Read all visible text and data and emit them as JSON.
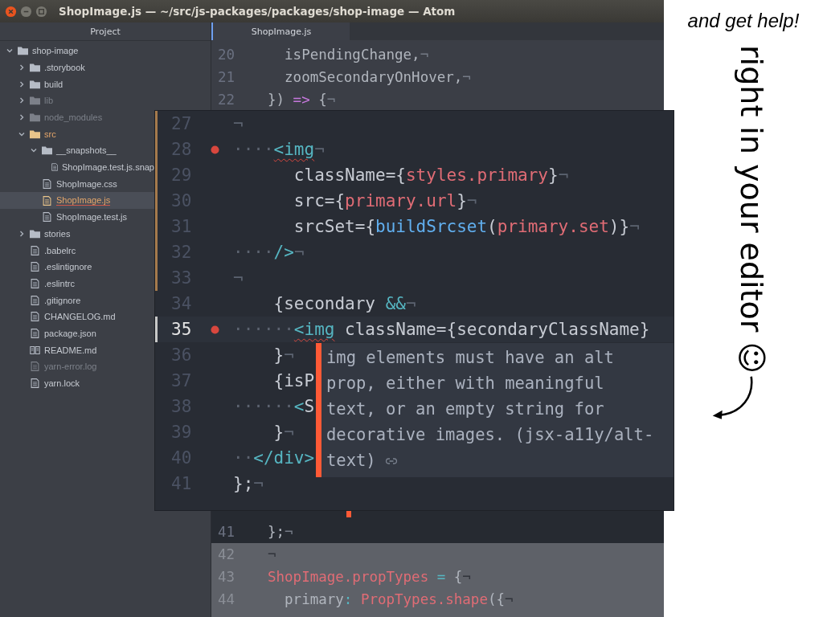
{
  "window": {
    "title": "ShopImage.js — ~/src/js-packages/packages/shop-image — Atom"
  },
  "sidebar": {
    "title": "Project",
    "tree": [
      {
        "name": "shop-image",
        "kind": "folder",
        "expanded": true,
        "ignored": false,
        "selected": false,
        "children": [
          {
            "name": ".storybook",
            "kind": "folder",
            "expanded": false,
            "ignored": false,
            "selected": false
          },
          {
            "name": "build",
            "kind": "folder",
            "expanded": false,
            "ignored": false,
            "selected": false
          },
          {
            "name": "lib",
            "kind": "folder",
            "expanded": false,
            "ignored": true,
            "selected": false
          },
          {
            "name": "node_modules",
            "kind": "folder",
            "expanded": false,
            "ignored": true,
            "selected": false
          },
          {
            "name": "src",
            "kind": "folder",
            "expanded": true,
            "ignored": false,
            "selected": false,
            "modified": true,
            "children": [
              {
                "name": "__snapshots__",
                "kind": "folder",
                "expanded": true,
                "ignored": false,
                "selected": false,
                "children": [
                  {
                    "name": "ShopImage.test.js.snap",
                    "kind": "file",
                    "ignored": false,
                    "selected": false
                  }
                ]
              },
              {
                "name": "ShopImage.css",
                "kind": "file",
                "ignored": false,
                "selected": false
              },
              {
                "name": "ShopImage.js",
                "kind": "file",
                "ignored": false,
                "selected": true,
                "modified": true
              },
              {
                "name": "ShopImage.test.js",
                "kind": "file",
                "ignored": false,
                "selected": false
              }
            ]
          },
          {
            "name": "stories",
            "kind": "folder",
            "expanded": false,
            "ignored": false,
            "selected": false
          },
          {
            "name": ".babelrc",
            "kind": "file",
            "ignored": false,
            "selected": false
          },
          {
            "name": ".eslintignore",
            "kind": "file",
            "ignored": false,
            "selected": false
          },
          {
            "name": ".eslintrc",
            "kind": "file",
            "ignored": false,
            "selected": false
          },
          {
            "name": ".gitignore",
            "kind": "file",
            "ignored": false,
            "selected": false
          },
          {
            "name": "CHANGELOG.md",
            "kind": "file",
            "ignored": false,
            "selected": false
          },
          {
            "name": "package.json",
            "kind": "file",
            "ignored": false,
            "selected": false
          },
          {
            "name": "README.md",
            "kind": "readme",
            "ignored": false,
            "selected": false
          },
          {
            "name": "yarn-error.log",
            "kind": "file",
            "ignored": true,
            "selected": false
          },
          {
            "name": "yarn.lock",
            "kind": "file",
            "ignored": false,
            "selected": false
          }
        ]
      }
    ]
  },
  "editor": {
    "tab": {
      "label": "ShopImage.js",
      "selected": true
    },
    "lines_top": [
      {
        "number": "20",
        "tokens": [
          {
            "text": "  isPendingChange,",
            "kind": "plain"
          },
          {
            "text": "¬",
            "kind": "invisible"
          }
        ]
      },
      {
        "number": "21",
        "tokens": [
          {
            "text": "  zoomSecondaryOnHover,",
            "kind": "plain"
          },
          {
            "text": "¬",
            "kind": "invisible"
          }
        ]
      },
      {
        "number": "22",
        "tokens": [
          {
            "text": "}) ",
            "kind": "plain"
          },
          {
            "text": "=>",
            "kind": "keyword"
          },
          {
            "text": " {",
            "kind": "plain"
          },
          {
            "text": "¬",
            "kind": "invisible"
          }
        ]
      }
    ],
    "lines_bottom": [
      {
        "number": "41",
        "tokens": [
          {
            "text": "};",
            "kind": "plain"
          },
          {
            "text": "¬",
            "kind": "invisible"
          }
        ]
      },
      {
        "number": "42",
        "tokens": [
          {
            "text": "¬",
            "kind": "invisible"
          }
        ]
      },
      {
        "number": "43",
        "tokens": [
          {
            "text": "ShopImage.propTypes",
            "kind": "string"
          },
          {
            "text": " = ",
            "kind": "operator"
          },
          {
            "text": "{",
            "kind": "plain"
          },
          {
            "text": "¬",
            "kind": "invisible"
          }
        ]
      },
      {
        "number": "44",
        "tokens": [
          {
            "text": "  primary",
            "kind": "plain"
          },
          {
            "text": ": ",
            "kind": "operator"
          },
          {
            "text": "PropTypes.shape",
            "kind": "string"
          },
          {
            "text": "({",
            "kind": "plain"
          },
          {
            "text": "¬",
            "kind": "invisible"
          }
        ]
      }
    ]
  },
  "zoom_panel": {
    "lines": [
      {
        "number": "27",
        "modified": true,
        "error": false,
        "current": false,
        "tokens": [
          {
            "text": "¬",
            "kind": "invisible"
          }
        ]
      },
      {
        "number": "28",
        "modified": true,
        "error": true,
        "current": false,
        "tokens": [
          {
            "text": "····",
            "kind": "invisible"
          },
          {
            "text": "<img",
            "kind": "tag",
            "lint": true
          },
          {
            "text": "¬",
            "kind": "invisible"
          }
        ]
      },
      {
        "number": "29",
        "modified": true,
        "error": false,
        "current": false,
        "tokens": [
          {
            "text": "      className=",
            "kind": "plain"
          },
          {
            "text": "{",
            "kind": "plain"
          },
          {
            "text": "styles.primary",
            "kind": "string"
          },
          {
            "text": "}",
            "kind": "plain"
          },
          {
            "text": "¬",
            "kind": "invisible"
          }
        ]
      },
      {
        "number": "30",
        "modified": true,
        "error": false,
        "current": false,
        "tokens": [
          {
            "text": "      src=",
            "kind": "plain"
          },
          {
            "text": "{",
            "kind": "plain"
          },
          {
            "text": "primary.url",
            "kind": "string"
          },
          {
            "text": "}",
            "kind": "plain"
          },
          {
            "text": "¬",
            "kind": "invisible"
          }
        ]
      },
      {
        "number": "31",
        "modified": true,
        "error": false,
        "current": false,
        "tokens": [
          {
            "text": "      srcSet=",
            "kind": "plain"
          },
          {
            "text": "{",
            "kind": "plain"
          },
          {
            "text": "buildSrcset",
            "kind": "function"
          },
          {
            "text": "(",
            "kind": "plain"
          },
          {
            "text": "primary.set",
            "kind": "string"
          },
          {
            "text": ")}",
            "kind": "plain"
          },
          {
            "text": "¬",
            "kind": "invisible"
          }
        ]
      },
      {
        "number": "32",
        "modified": true,
        "error": false,
        "current": false,
        "tokens": [
          {
            "text": "····",
            "kind": "invisible"
          },
          {
            "text": "/>",
            "kind": "tag"
          },
          {
            "text": "¬",
            "kind": "invisible"
          }
        ]
      },
      {
        "number": "33",
        "modified": true,
        "error": false,
        "current": false,
        "tokens": [
          {
            "text": "¬",
            "kind": "invisible"
          }
        ]
      },
      {
        "number": "34",
        "modified": false,
        "error": false,
        "current": false,
        "tokens": [
          {
            "text": "    {secondary ",
            "kind": "plain"
          },
          {
            "text": "&&",
            "kind": "operator"
          },
          {
            "text": "¬",
            "kind": "invisible"
          }
        ]
      },
      {
        "number": "35",
        "modified": false,
        "error": true,
        "current": true,
        "tokens": [
          {
            "text": "······",
            "kind": "invisible"
          },
          {
            "text": "<img",
            "kind": "tag",
            "lint": true
          },
          {
            "text": " className=",
            "kind": "plain"
          },
          {
            "text": "{secondaryClassName}",
            "kind": "plain"
          }
        ]
      },
      {
        "number": "36",
        "modified": false,
        "error": false,
        "current": false,
        "tokens": [
          {
            "text": "    }",
            "kind": "plain"
          },
          {
            "text": "¬",
            "kind": "invisible"
          }
        ]
      },
      {
        "number": "37",
        "modified": false,
        "error": false,
        "current": false,
        "tokens": [
          {
            "text": "    {isP",
            "kind": "plain"
          }
        ]
      },
      {
        "number": "38",
        "modified": false,
        "error": false,
        "current": false,
        "tokens": [
          {
            "text": "······",
            "kind": "invisible"
          },
          {
            "text": "<",
            "kind": "tag"
          },
          {
            "text": "S",
            "kind": "plain"
          }
        ]
      },
      {
        "number": "39",
        "modified": false,
        "error": false,
        "current": false,
        "tokens": [
          {
            "text": "    }",
            "kind": "plain"
          },
          {
            "text": "¬",
            "kind": "invisible"
          }
        ]
      },
      {
        "number": "40",
        "modified": false,
        "error": false,
        "current": false,
        "tokens": [
          {
            "text": "··",
            "kind": "invisible"
          },
          {
            "text": "</div>",
            "kind": "tag"
          }
        ]
      },
      {
        "number": "41",
        "modified": false,
        "error": false,
        "current": false,
        "tokens": [
          {
            "text": "};",
            "kind": "plain"
          },
          {
            "text": "¬",
            "kind": "invisible"
          }
        ]
      }
    ],
    "tooltip": {
      "text": "img elements must have an alt prop, either with meaningful text, or an empty string for decorative images. (jsx-a11y/alt-text)"
    }
  },
  "caption": {
    "note": "and get help!",
    "vertical_text": "right in your editor ☺"
  }
}
